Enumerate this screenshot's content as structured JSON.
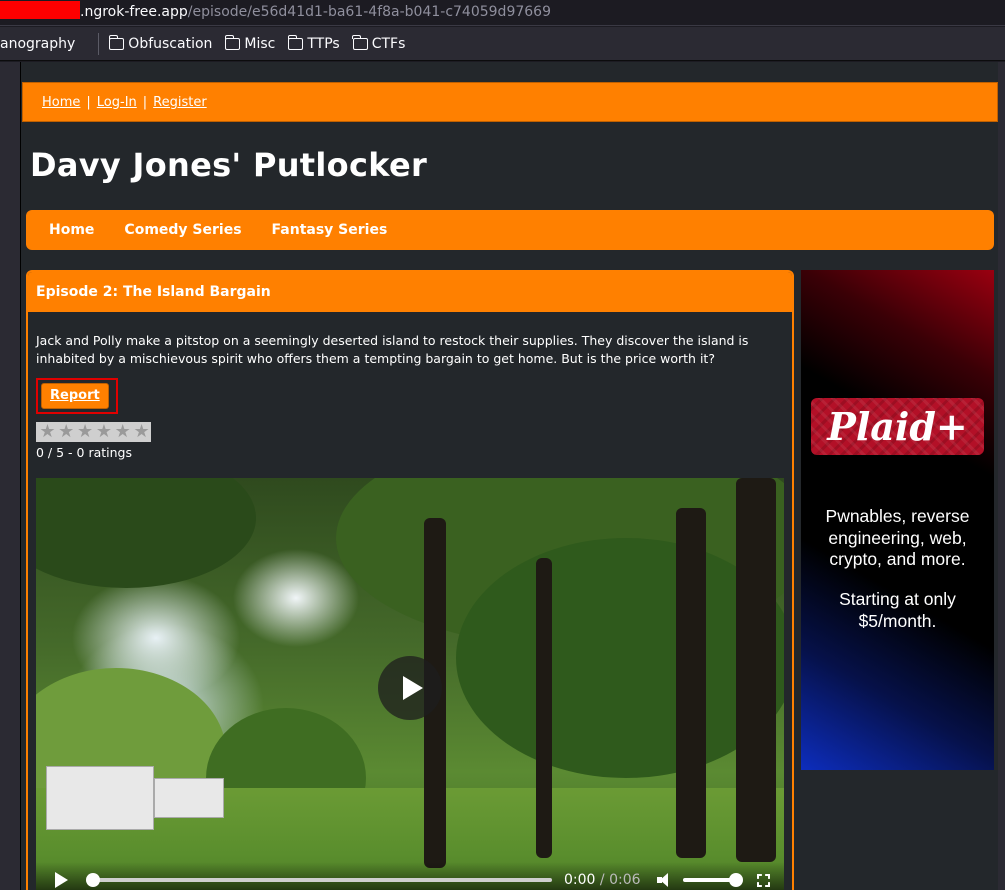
{
  "browser": {
    "url_host": ".ngrok-free.app",
    "url_path": "/episode/e56d41d1-ba61-4f8a-b041-c74059d97669",
    "bookmarks_partial": "anography",
    "bookmarks": [
      "Obfuscation",
      "Misc",
      "TTPs",
      "CTFs"
    ]
  },
  "topnav": {
    "home": "Home",
    "sep": "|",
    "login": "Log-In",
    "register": "Register"
  },
  "site": {
    "title": "Davy Jones' Putlocker"
  },
  "mainnav": [
    "Home",
    "Comedy Series",
    "Fantasy Series"
  ],
  "episode": {
    "title": "Episode 2: The Island Bargain",
    "description": "Jack and Polly make a pitstop on a seemingly deserted island to restock their supplies. They discover the island is inhabited by a mischievous spirit who offers them a tempting bargain to get home. But is the price worth it?",
    "report_label": "Report",
    "rating_text": "0 / 5 - 0 ratings",
    "rating_value": 0,
    "rating_max": 5
  },
  "video": {
    "current_time": "0:00",
    "separator": "/",
    "duration": "0:06"
  },
  "ad": {
    "logo_text": "Plaid+",
    "line1": "Pwnables, reverse engineering, web, crypto, and more.",
    "line2": "Starting at only $5/month."
  },
  "colors": {
    "accent": "#ff8000",
    "page_bg": "#23272b",
    "report_highlight": "#e00000",
    "ad_red": "#b31027",
    "ad_blue": "#0d2dbd"
  }
}
